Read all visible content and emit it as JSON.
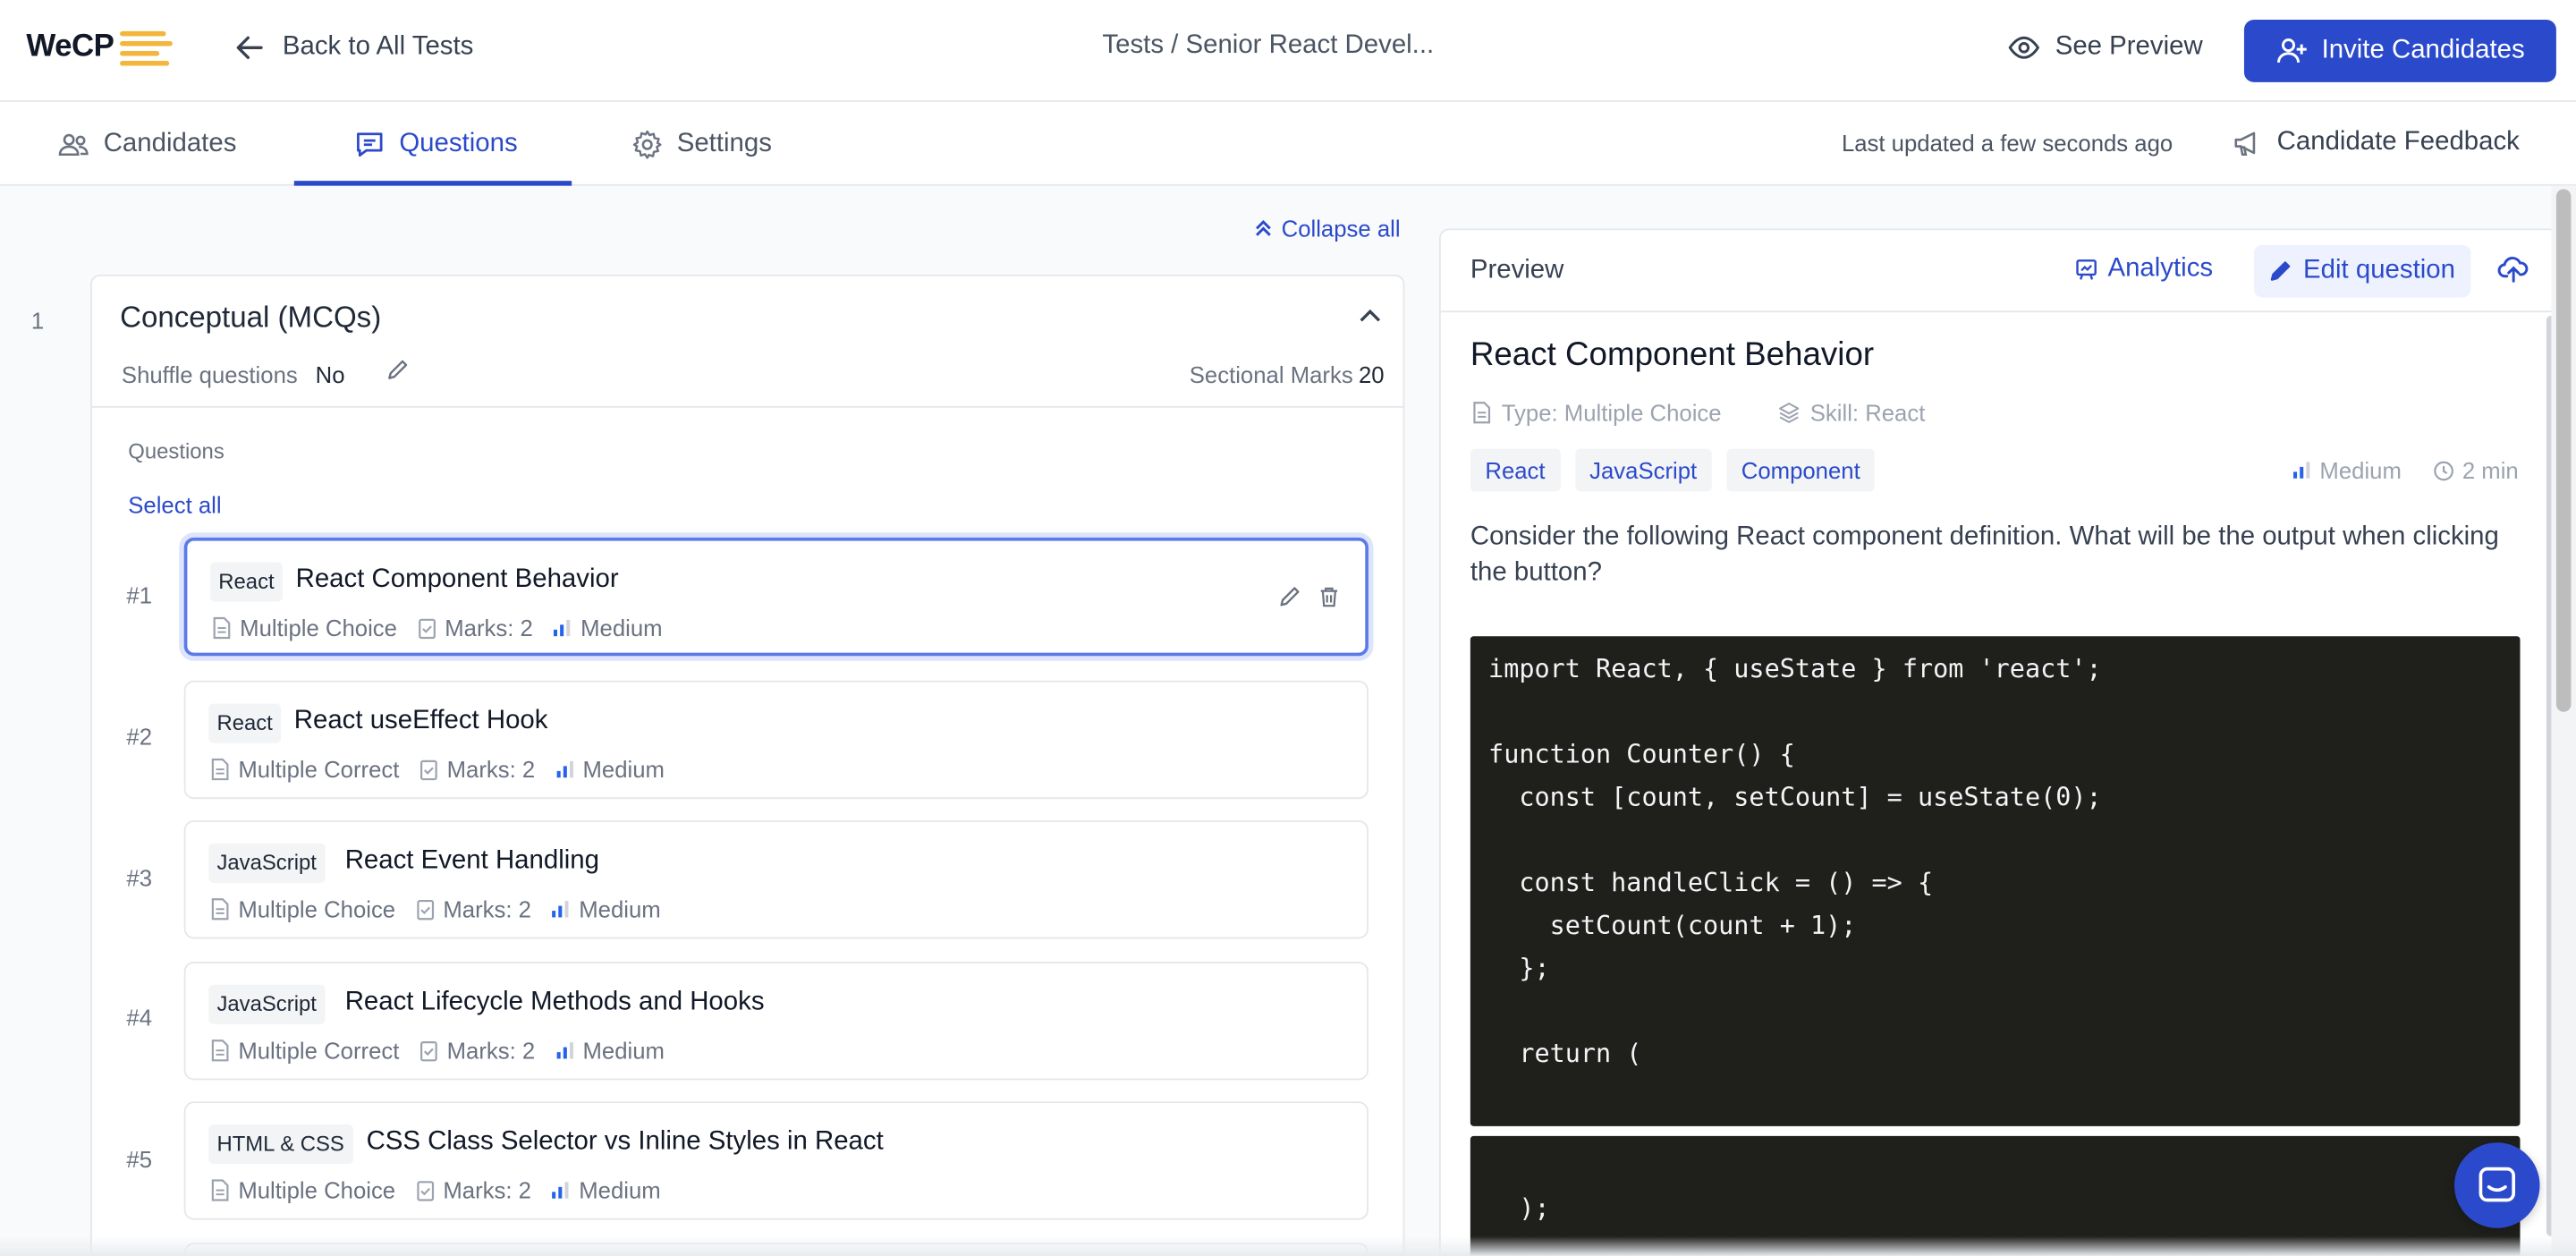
{
  "header": {
    "logo_text": "WeCP",
    "back_label": "Back to All Tests",
    "breadcrumb": "Tests / Senior React Devel...",
    "see_preview": "See Preview",
    "invite": "Invite Candidates"
  },
  "tabs": [
    {
      "label": "Candidates",
      "icon": "users-icon"
    },
    {
      "label": "Questions",
      "icon": "chat-icon",
      "active": true
    },
    {
      "label": "Settings",
      "icon": "gear-icon"
    }
  ],
  "status": {
    "last_updated": "Last updated a few seconds ago",
    "feedback": "Candidate Feedback"
  },
  "section": {
    "collapse_all": "Collapse all",
    "number": "1",
    "title": "Conceptual (MCQs)",
    "shuffle_label": "Shuffle questions",
    "shuffle_value": "No",
    "marks_label": "Sectional Marks",
    "marks_value": "20",
    "questions_heading": "Questions",
    "select_all": "Select all",
    "questions": [
      {
        "num": "#1",
        "tag": "React",
        "title": "React Component Behavior",
        "type": "Multiple Choice",
        "marks": "Marks: 2",
        "difficulty": "Medium",
        "selected": true
      },
      {
        "num": "#2",
        "tag": "React",
        "title": "React useEffect Hook",
        "type": "Multiple Correct",
        "marks": "Marks: 2",
        "difficulty": "Medium"
      },
      {
        "num": "#3",
        "tag": "JavaScript",
        "title": "React Event Handling",
        "type": "Multiple Choice",
        "marks": "Marks: 2",
        "difficulty": "Medium"
      },
      {
        "num": "#4",
        "tag": "JavaScript",
        "title": "React Lifecycle Methods and Hooks",
        "type": "Multiple Correct",
        "marks": "Marks: 2",
        "difficulty": "Medium"
      },
      {
        "num": "#5",
        "tag": "HTML & CSS",
        "title": "CSS Class Selector vs Inline Styles in React",
        "type": "Multiple Choice",
        "marks": "Marks: 2",
        "difficulty": "Medium"
      }
    ]
  },
  "preview": {
    "label": "Preview",
    "analytics": "Analytics",
    "edit": "Edit question",
    "title": "React Component Behavior",
    "type": "Type: Multiple Choice",
    "skill": "Skill: React",
    "tags": [
      "React",
      "JavaScript",
      "Component"
    ],
    "difficulty": "Medium",
    "duration": "2 min",
    "description": "Consider the following React component definition. What will be the output when clicking the button?",
    "code_block_1": [
      "import React, { useState } from 'react';",
      "",
      "function Counter() {",
      "  const [count, setCount] = useState(0);",
      "",
      "  const handleClick = () => {",
      "    setCount(count + 1);",
      "  };",
      "",
      "  return ("
    ],
    "code_block_2": [
      "",
      "  );"
    ]
  },
  "colors": {
    "accent": "#2b4acb",
    "logo_bars": "#f3b53a",
    "code_bg": "#1f1f1c"
  }
}
